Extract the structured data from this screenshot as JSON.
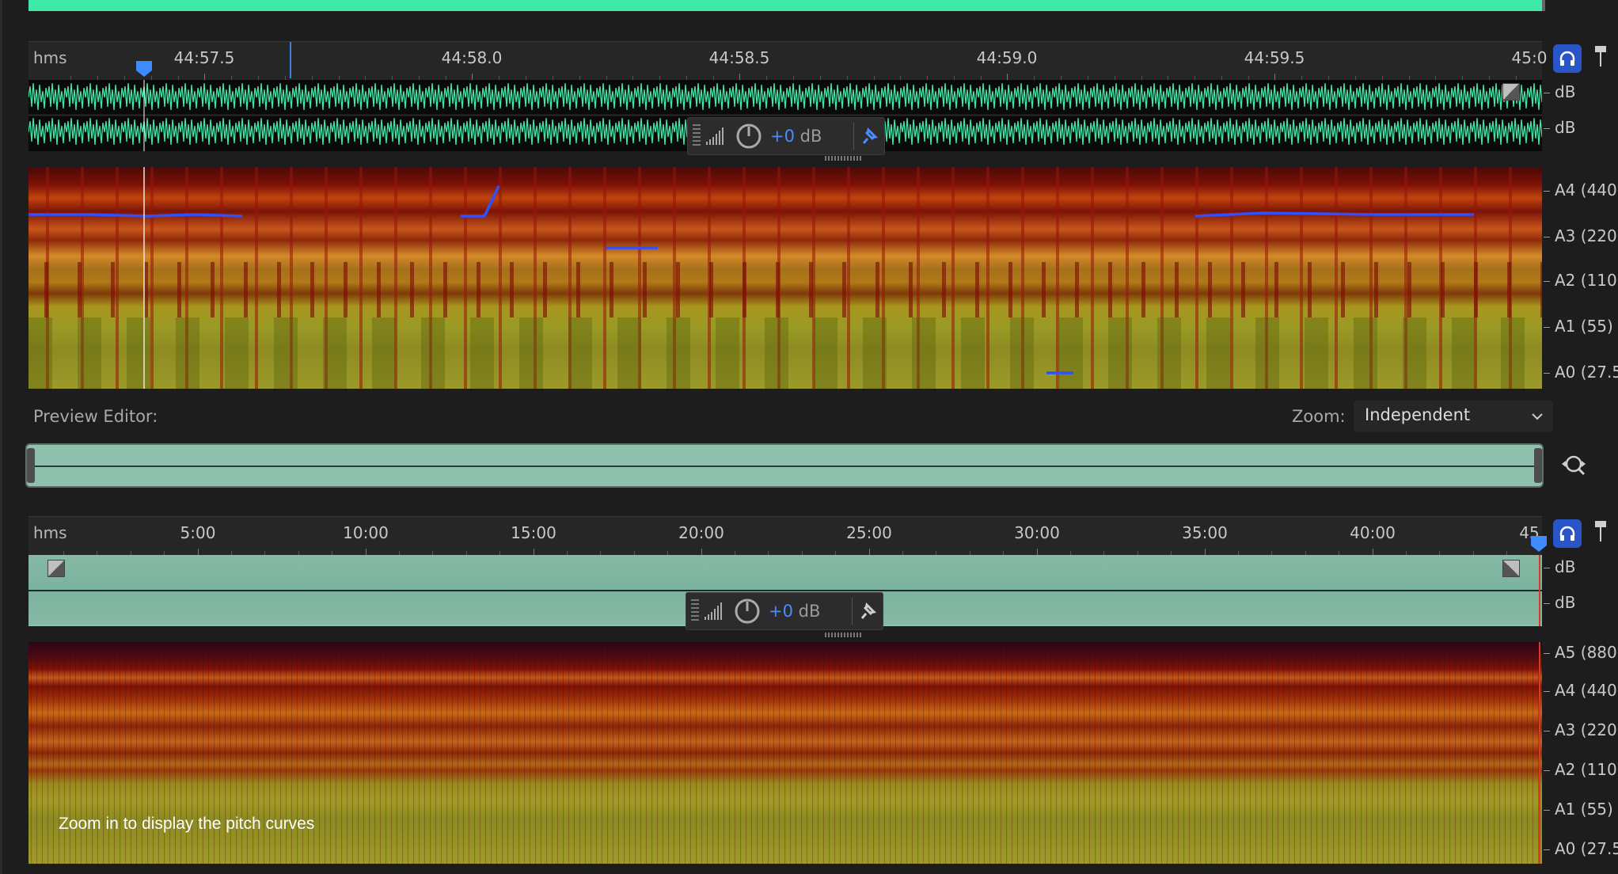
{
  "top_panel": {
    "ruler": {
      "unit": "hms",
      "labels": [
        "44:57.5",
        "44:58.0",
        "44:58.5",
        "44:59.0",
        "44:59.5",
        "45:0"
      ]
    },
    "waveform_channel_labels": [
      "dB",
      "dB"
    ],
    "hud": {
      "value": "+0",
      "unit": "dB"
    },
    "pitch_labels": [
      "A4 (440)",
      "A3 (220)",
      "A2 (110)",
      "A1 (55)",
      "A0 (27.5"
    ]
  },
  "preview_editor": {
    "label": "Preview Editor:",
    "zoom_label": "Zoom:",
    "zoom_value": "Independent"
  },
  "bottom_panel": {
    "ruler": {
      "unit": "hms",
      "labels": [
        "5:00",
        "10:00",
        "15:00",
        "20:00",
        "25:00",
        "30:00",
        "35:00",
        "40:00",
        "45"
      ]
    },
    "waveform_channel_labels": [
      "dB",
      "dB"
    ],
    "hud": {
      "value": "+0",
      "unit": "dB"
    },
    "pitch_labels": [
      "A5 (880)",
      "A4 (440)",
      "A3 (220)",
      "A2 (110)",
      "A1 (55)",
      "A0 (27.5"
    ],
    "message": "Zoom in to display the pitch curves"
  },
  "colors": {
    "waveform": "#3ee8a6",
    "overview": "#8fc0ad",
    "pitch_curve": "#3050ff",
    "playhead_marker": "#3d8bff",
    "panel_bg": "#1d1d1d"
  },
  "icons": [
    "headphones-icon",
    "pin-icon",
    "zoom-icon",
    "chevron-down-icon",
    "fade-in-icon",
    "fade-out-icon",
    "volume-knob-icon",
    "level-meter-icon"
  ]
}
